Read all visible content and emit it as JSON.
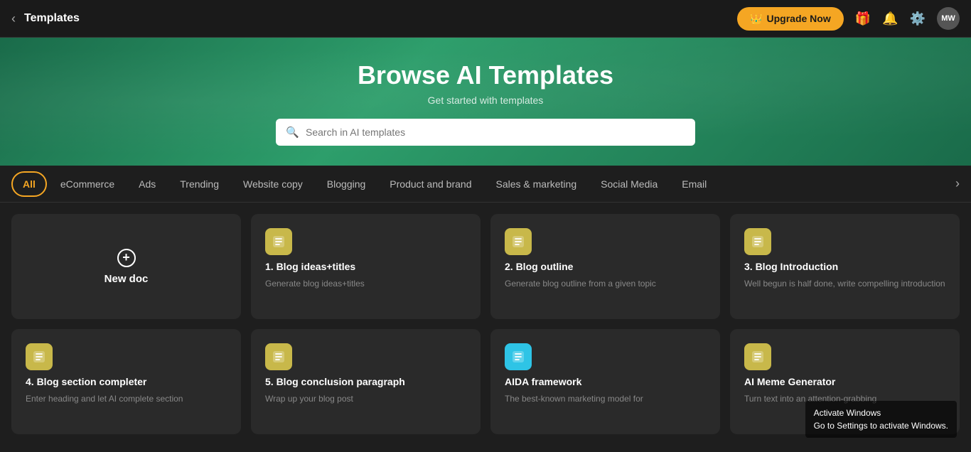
{
  "topnav": {
    "title": "Templates",
    "back_label": "‹",
    "upgrade_label": "Upgrade Now",
    "upgrade_icon": "👑",
    "gift_icon": "🎁",
    "bell_icon": "🔔",
    "settings_icon": "⚙️",
    "avatar_label": "MW"
  },
  "hero": {
    "title": "Browse AI Templates",
    "subtitle": "Get started with templates",
    "search_placeholder": "Search in AI templates"
  },
  "tabs": [
    {
      "id": "all",
      "label": "All",
      "active": true
    },
    {
      "id": "ecommerce",
      "label": "eCommerce",
      "active": false
    },
    {
      "id": "ads",
      "label": "Ads",
      "active": false
    },
    {
      "id": "trending",
      "label": "Trending",
      "active": false
    },
    {
      "id": "website-copy",
      "label": "Website copy",
      "active": false
    },
    {
      "id": "blogging",
      "label": "Blogging",
      "active": false
    },
    {
      "id": "product-brand",
      "label": "Product and brand",
      "active": false
    },
    {
      "id": "sales-marketing",
      "label": "Sales & marketing",
      "active": false
    },
    {
      "id": "social-media",
      "label": "Social Media",
      "active": false
    },
    {
      "id": "email",
      "label": "Email",
      "active": false
    }
  ],
  "cards": [
    {
      "id": "new-doc",
      "type": "new",
      "label": "New doc"
    },
    {
      "id": "blog-ideas-titles",
      "type": "template",
      "icon_type": "yellow",
      "icon": "✦",
      "title": "1. Blog ideas+titles",
      "desc": "Generate blog ideas+titles"
    },
    {
      "id": "blog-outline",
      "type": "template",
      "icon_type": "yellow",
      "icon": "✦",
      "title": "2. Blog outline",
      "desc": "Generate blog outline from a given topic"
    },
    {
      "id": "blog-introduction",
      "type": "template",
      "icon_type": "yellow",
      "icon": "✦",
      "title": "3. Blog Introduction",
      "desc": "Well begun is half done, write compelling introduction"
    },
    {
      "id": "blog-section-completer",
      "type": "template",
      "icon_type": "yellow",
      "icon": "✦",
      "title": "4. Blog section completer",
      "desc": "Enter heading and let AI complete section"
    },
    {
      "id": "blog-conclusion",
      "type": "template",
      "icon_type": "yellow",
      "icon": "✦",
      "title": "5. Blog conclusion paragraph",
      "desc": "Wrap up your blog post"
    },
    {
      "id": "aida-framework",
      "type": "template",
      "icon_type": "cyan",
      "icon": "✉",
      "title": "AIDA framework",
      "desc": "The best-known marketing model for"
    },
    {
      "id": "ai-meme-generator",
      "type": "template",
      "icon_type": "yellow",
      "icon": "✦",
      "title": "AI Meme Generator",
      "desc": "Turn text into an attention-grabbing"
    }
  ],
  "watermark": {
    "line1": "Activate Windows",
    "line2": "Go to Settings to activate Windows."
  }
}
